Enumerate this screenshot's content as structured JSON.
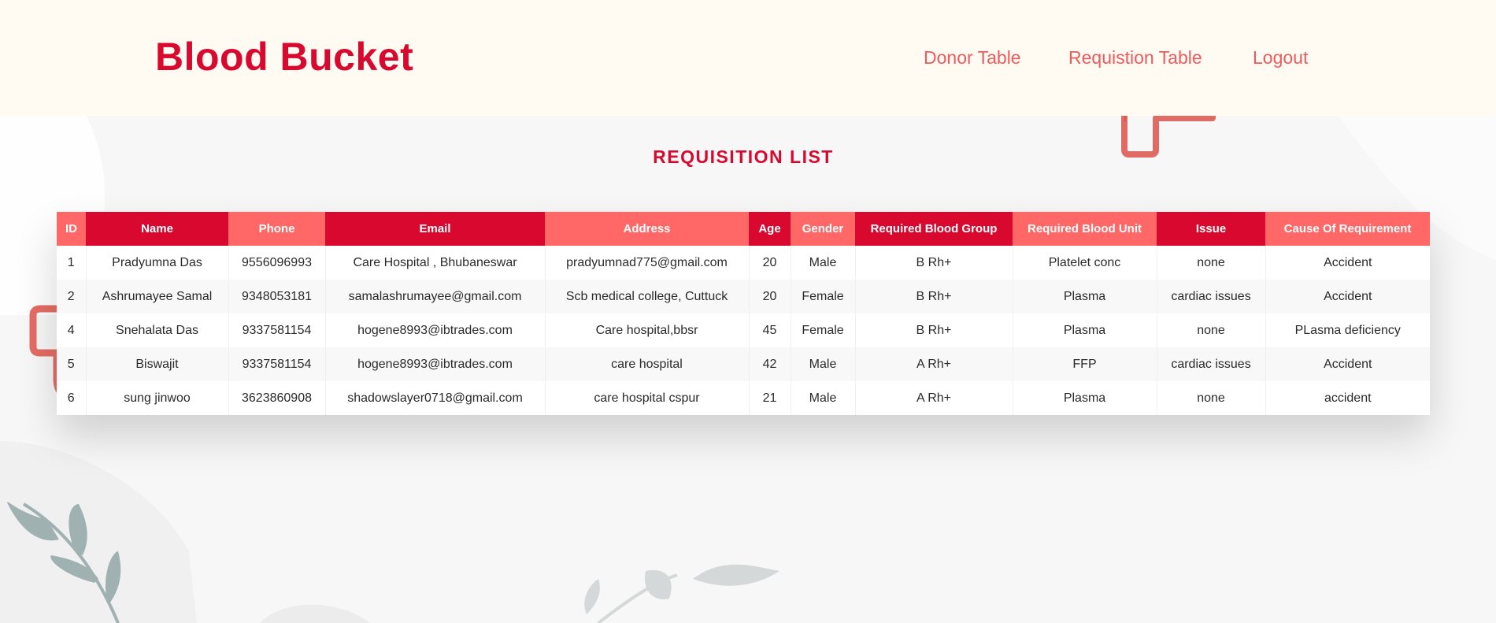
{
  "app": {
    "brand": "Blood Bucket"
  },
  "nav": {
    "items": [
      {
        "label": "Donor Table"
      },
      {
        "label": "Requistion Table"
      },
      {
        "label": "Logout"
      }
    ]
  },
  "page": {
    "title": "REQUISITION LIST"
  },
  "table": {
    "headers": [
      "ID",
      "Name",
      "Phone",
      "Email",
      "Address",
      "Age",
      "Gender",
      "Required Blood Group",
      "Required Blood Unit",
      "Issue",
      "Cause Of Requirement"
    ],
    "rows": [
      [
        "1",
        "Pradyumna Das",
        "9556096993",
        "Care Hospital , Bhubaneswar",
        "pradyumnad775@gmail.com",
        "20",
        "Male",
        "B Rh+",
        "Platelet conc",
        "none",
        "Accident"
      ],
      [
        "2",
        "Ashrumayee Samal",
        "9348053181",
        "samalashrumayee@gmail.com",
        "Scb medical college, Cuttuck",
        "20",
        "Female",
        "B Rh+",
        "Plasma",
        "cardiac issues",
        "Accident"
      ],
      [
        "4",
        "Snehalata Das",
        "9337581154",
        "hogene8993@ibtrades.com",
        "Care hospital,bbsr",
        "45",
        "Female",
        "B Rh+",
        "Plasma",
        "none",
        "PLasma deficiency"
      ],
      [
        "5",
        "Biswajit",
        "9337581154",
        "hogene8993@ibtrades.com",
        "care hospital",
        "42",
        "Male",
        "A Rh+",
        "FFP",
        "cardiac issues",
        "Accident"
      ],
      [
        "6",
        "sung jinwoo",
        "3623860908",
        "shadowslayer0718@gmail.com",
        "care hospital cspur",
        "21",
        "Male",
        "A Rh+",
        "Plasma",
        "none",
        "accident"
      ]
    ]
  },
  "colors": {
    "brand": "#d9082f",
    "nav_link": "#ef5b5d",
    "header_dark": "#d9082f",
    "header_light": "#ff6866",
    "header_bg": "#fffaf2"
  }
}
